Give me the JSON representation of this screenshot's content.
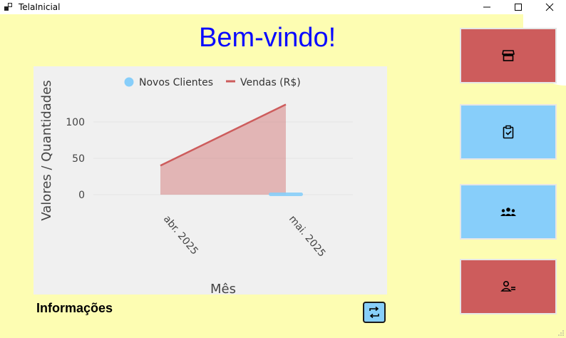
{
  "window": {
    "title": "TelaInicial"
  },
  "main": {
    "welcome": "Bem-vindo!",
    "info_label": "Informações"
  },
  "side_buttons": [
    {
      "name": "store-button",
      "icon": "store-icon",
      "color": "#cd5c5c"
    },
    {
      "name": "clipboard-check-button",
      "icon": "clipboard-check-icon",
      "color": "#87cefa"
    },
    {
      "name": "group-button",
      "icon": "group-icon",
      "color": "#87cefa"
    },
    {
      "name": "user-manage-button",
      "icon": "user-manage-icon",
      "color": "#cd5c5c"
    }
  ],
  "toggle_button": {
    "icon": "swap-icon",
    "color": "#87cefa"
  },
  "chart_data": {
    "type": "area",
    "categories": [
      "abr. 2025",
      "mai. 2025"
    ],
    "series": [
      {
        "name": "Novos Clientes",
        "values": [
          0,
          0
        ],
        "color": "#87cefa",
        "style": "bar"
      },
      {
        "name": "Vendas (R$)",
        "values": [
          40,
          124
        ],
        "color": "#cd5c5c",
        "style": "area"
      }
    ],
    "xlabel": "Mês",
    "ylabel": "Valores / Quantidades",
    "yticks": [
      0,
      50,
      100
    ],
    "ylim": [
      0,
      130
    ],
    "legend": "top",
    "grid": true
  }
}
